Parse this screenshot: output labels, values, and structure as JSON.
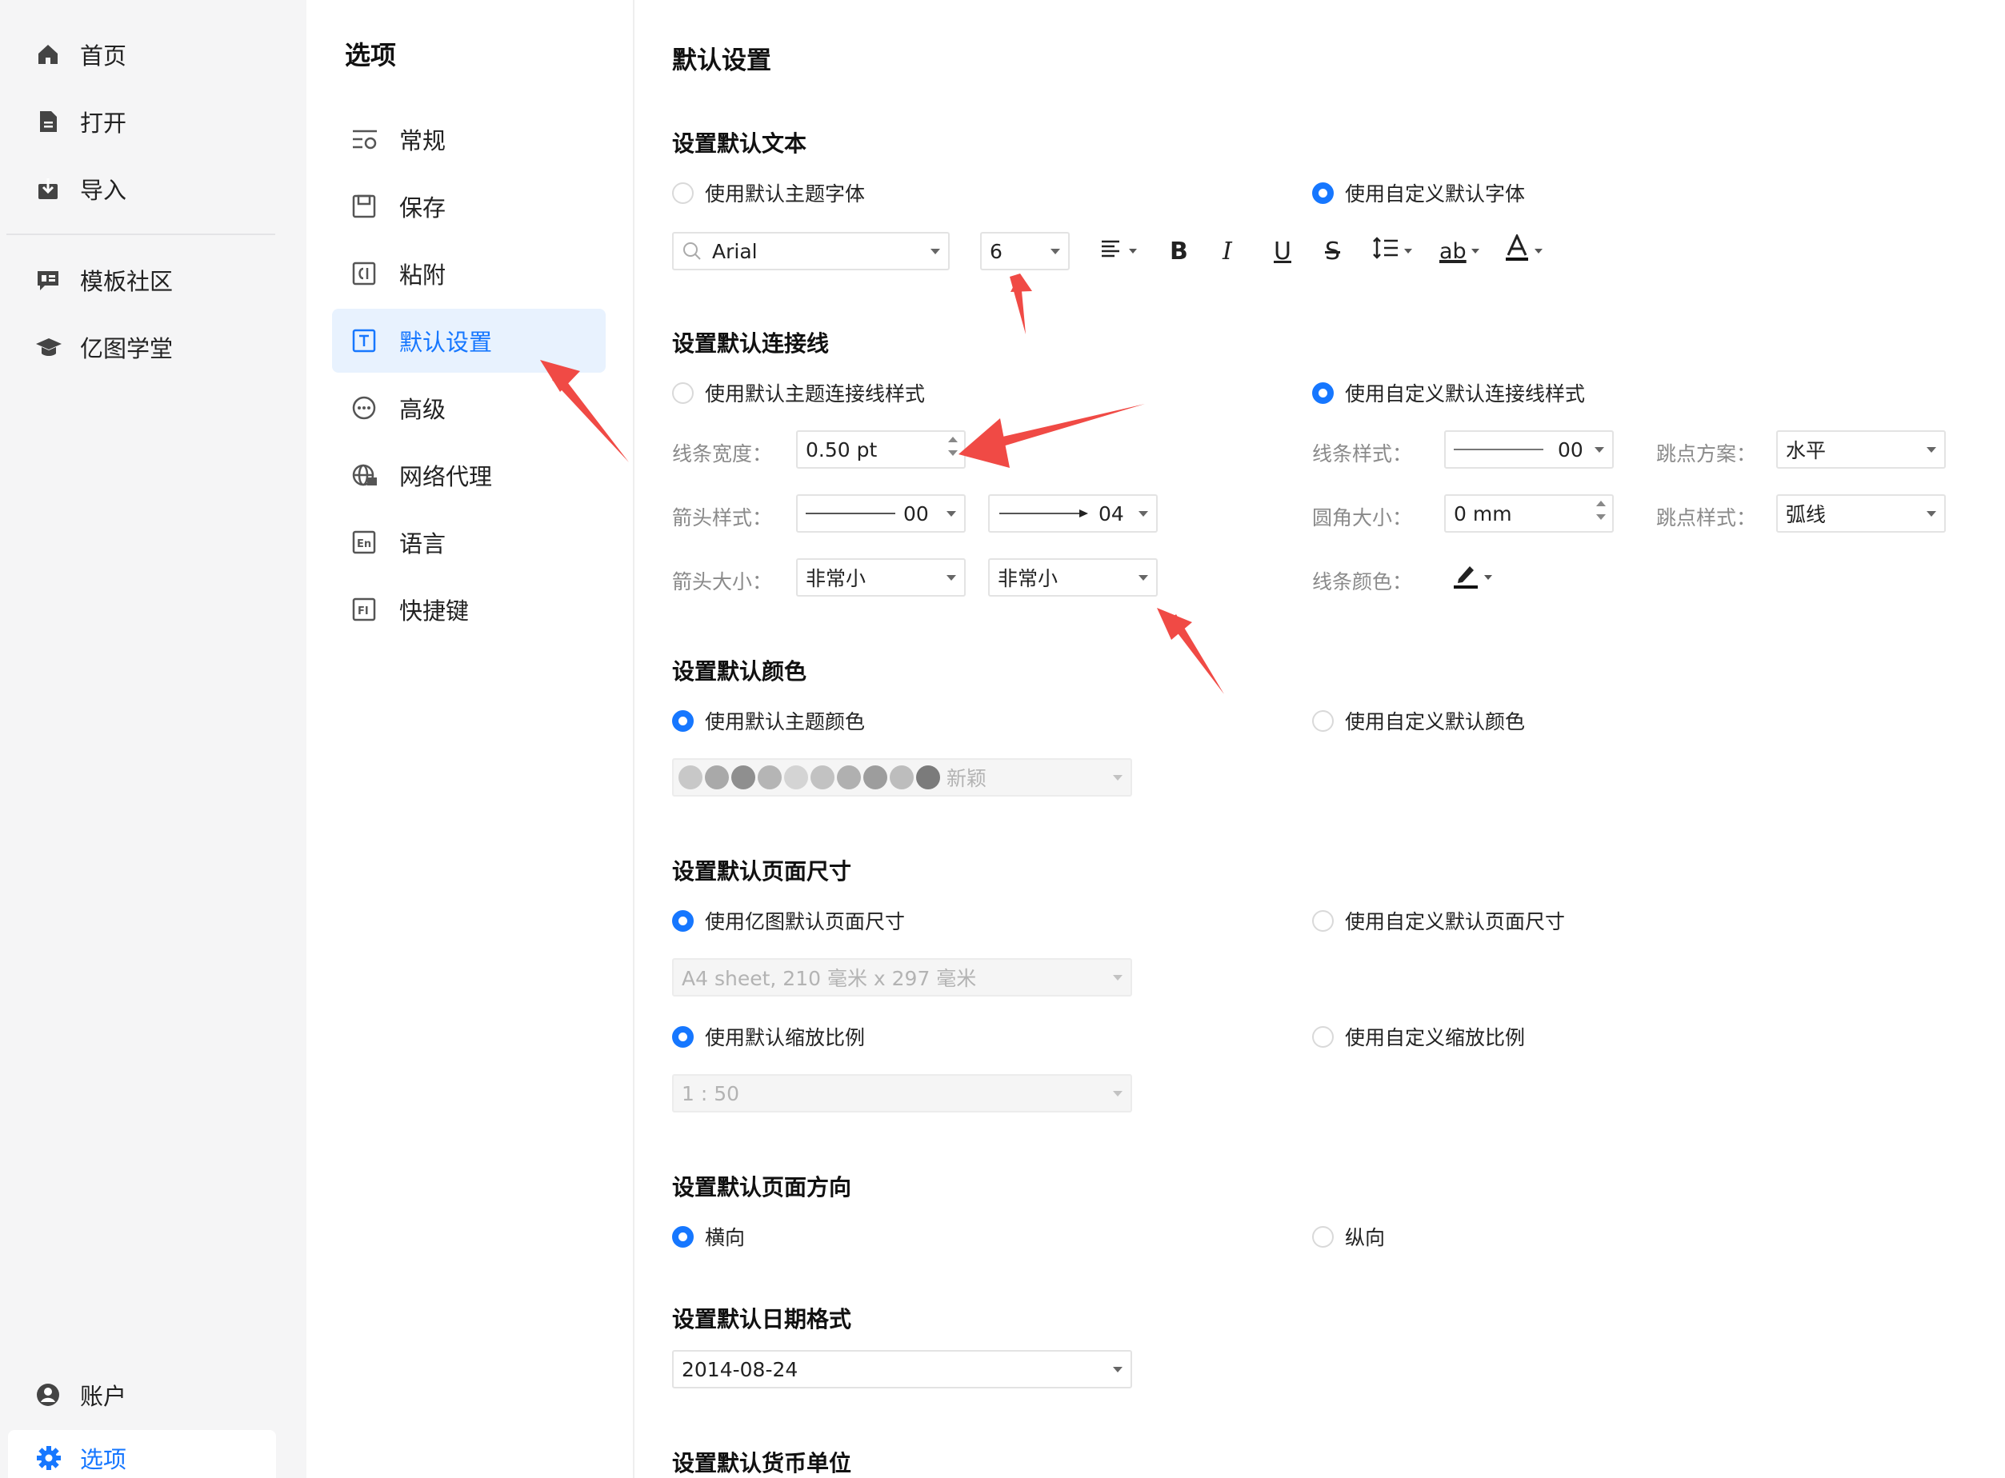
{
  "nav": {
    "items": [
      {
        "label": "首页"
      },
      {
        "label": "打开"
      },
      {
        "label": "导入"
      },
      {
        "label": "模板社区"
      },
      {
        "label": "亿图学堂"
      }
    ],
    "account": "账户",
    "options": "选项"
  },
  "menu": {
    "title": "选项",
    "items": [
      {
        "label": "常规"
      },
      {
        "label": "保存"
      },
      {
        "label": "粘附"
      },
      {
        "label": "默认设置"
      },
      {
        "label": "高级"
      },
      {
        "label": "网络代理"
      },
      {
        "label": "语言"
      },
      {
        "label": "快捷键"
      }
    ]
  },
  "main": {
    "title": "默认设置",
    "text": {
      "section": "设置默认文本",
      "radio_theme": "使用默认主题字体",
      "radio_custom": "使用自定义默认字体",
      "font_name": "Arial",
      "font_size": "6",
      "underline_text": "ab"
    },
    "connector": {
      "section": "设置默认连接线",
      "radio_theme": "使用默认主题连接线样式",
      "radio_custom": "使用自定义默认连接线样式",
      "line_width_label": "线条宽度：",
      "line_width_value": "0.50 pt",
      "arrow_style_label": "箭头样式：",
      "arrow_start_value": "00",
      "arrow_end_value": "04",
      "arrow_size_label": "箭头大小：",
      "arrow_size_start": "非常小",
      "arrow_size_end": "非常小",
      "line_style_label": "线条样式：",
      "line_style_value": "00",
      "corner_label": "圆角大小：",
      "corner_value": "0 mm",
      "line_color_label": "线条颜色：",
      "jump_scheme_label": "跳点方案：",
      "jump_scheme_value": "水平",
      "jump_style_label": "跳点样式：",
      "jump_style_value": "弧线"
    },
    "color": {
      "section": "设置默认颜色",
      "radio_theme": "使用默认主题颜色",
      "radio_custom": "使用自定义默认颜色",
      "palette_name": "新颖",
      "swatches": [
        "#c8c8c8",
        "#a9a9a9",
        "#8f8f8f",
        "#b5b5b5",
        "#d4d4d4",
        "#c2c2c2",
        "#b0b0b0",
        "#9d9d9d",
        "#bdbdbd",
        "#7b7b7b"
      ]
    },
    "page_size": {
      "section": "设置默认页面尺寸",
      "radio_default": "使用亿图默认页面尺寸",
      "radio_custom": "使用自定义默认页面尺寸",
      "size_value": "A4 sheet, 210 毫米 x 297 毫米",
      "radio_scale_default": "使用默认缩放比例",
      "radio_scale_custom": "使用自定义缩放比例",
      "scale_value": "1 : 50"
    },
    "orientation": {
      "section": "设置默认页面方向",
      "landscape": "横向",
      "portrait": "纵向"
    },
    "date": {
      "section": "设置默认日期格式",
      "value": "2014-08-24"
    },
    "currency": {
      "section": "设置默认货币单位"
    }
  },
  "colors": {
    "accent": "#1677ff",
    "annotation_arrow": "#f04a45"
  }
}
